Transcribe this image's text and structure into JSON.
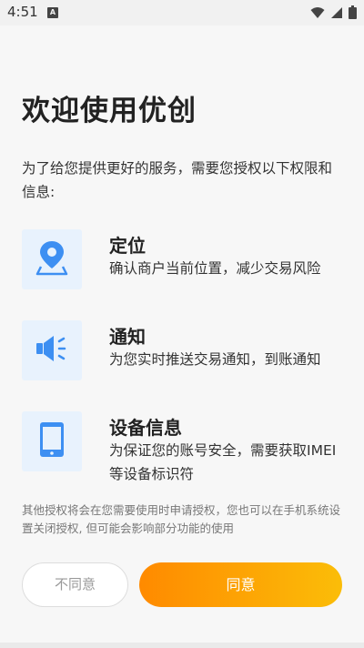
{
  "status_bar": {
    "time": "4:51",
    "notification_icon": "a-app-icon",
    "icons": [
      "wifi-icon",
      "signal-icon",
      "battery-icon"
    ]
  },
  "title": "欢迎使用优创",
  "intro": "为了给您提供更好的服务，需要您授权以下权限和信息:",
  "permissions": [
    {
      "icon": "location-pin-icon",
      "title": "定位",
      "desc": "确认商户当前位置，减少交易风险"
    },
    {
      "icon": "speaker-icon",
      "title": "通知",
      "desc": "为您实时推送交易通知，到账通知"
    },
    {
      "icon": "phone-device-icon",
      "title": "设备信息",
      "desc": "为保证您的账号安全，需要获取IMEI等设备标识符"
    }
  ],
  "footnote": "其他授权将会在您需要使用时申请授权，您也可以在手机系统设置关闭授权, 但可能会影响部分功能的使用",
  "buttons": {
    "decline": "不同意",
    "agree": "同意"
  },
  "colors": {
    "icon_blue": "#3d8ff2",
    "icon_bg": "#e8f2fd",
    "agree_gradient_start": "#ff8a00",
    "agree_gradient_end": "#fbbd08"
  }
}
